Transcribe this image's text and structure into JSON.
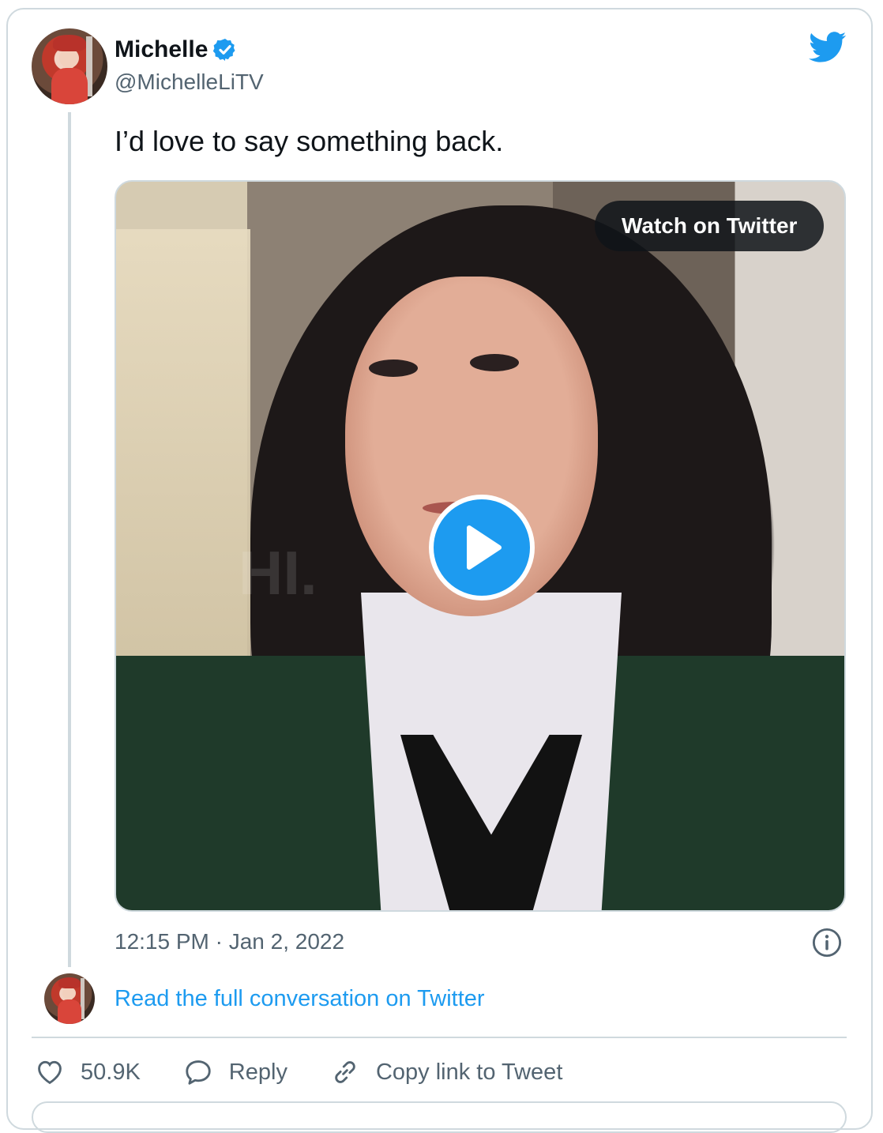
{
  "author": {
    "name": "Michelle",
    "handle": "@MichelleLiTV",
    "verified": true
  },
  "tweet": {
    "text": "I’d love to say something back.",
    "timestamp": "12:15 PM · Jan 2, 2022"
  },
  "media": {
    "watch_label": "Watch on Twitter",
    "watermark": "HI."
  },
  "conversation_link": "Read the full conversation on Twitter",
  "actions": {
    "likes": "50.9K",
    "reply_label": "Reply",
    "copy_link_label": "Copy link to Tweet"
  },
  "icons": {
    "verified": "verified-badge-icon",
    "brand": "twitter-bird-icon",
    "play": "play-icon",
    "info": "info-icon",
    "like": "heart-icon",
    "reply": "speech-bubble-icon",
    "copy": "link-icon"
  },
  "colors": {
    "accent": "#1d9bf0",
    "text": "#0f1419",
    "muted": "#536471",
    "border": "#cfd9de"
  }
}
